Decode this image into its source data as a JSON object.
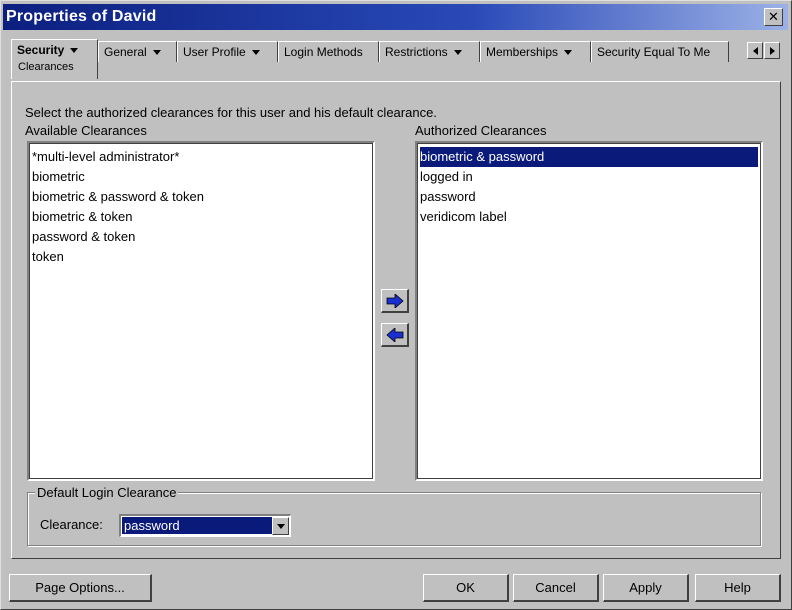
{
  "window": {
    "title": "Properties of David",
    "close_label": "✕"
  },
  "tabs": [
    {
      "label": "Security",
      "sub": "Clearances",
      "has_menu": true,
      "active": true
    },
    {
      "label": "General",
      "has_menu": true
    },
    {
      "label": "User Profile",
      "has_menu": true
    },
    {
      "label": "Login Methods",
      "has_menu": false
    },
    {
      "label": "Restrictions",
      "has_menu": true
    },
    {
      "label": "Memberships",
      "has_menu": true
    },
    {
      "label": "Security Equal To Me",
      "has_menu": false
    }
  ],
  "content": {
    "instruction": "Select the authorized clearances for this user and his default clearance.",
    "available": {
      "label": "Available Clearances",
      "items": [
        "*multi-level administrator*",
        "biometric",
        "biometric & password & token",
        "biometric & token",
        "password & token",
        "token"
      ]
    },
    "authorized": {
      "label": "Authorized Clearances",
      "items": [
        "biometric & password",
        "logged in",
        "password",
        "veridicom label"
      ],
      "selected_index": 0
    }
  },
  "default_login": {
    "legend": "Default Login Clearance",
    "label": "Clearance:",
    "value": "password"
  },
  "buttons": {
    "page_options": "Page Options...",
    "ok": "OK",
    "cancel": "Cancel",
    "apply": "Apply",
    "help": "Help"
  },
  "colors": {
    "selection": "#0a1a7a",
    "arrow_icon": "#1a2fd0",
    "titlebar": "#0b1f7f"
  }
}
